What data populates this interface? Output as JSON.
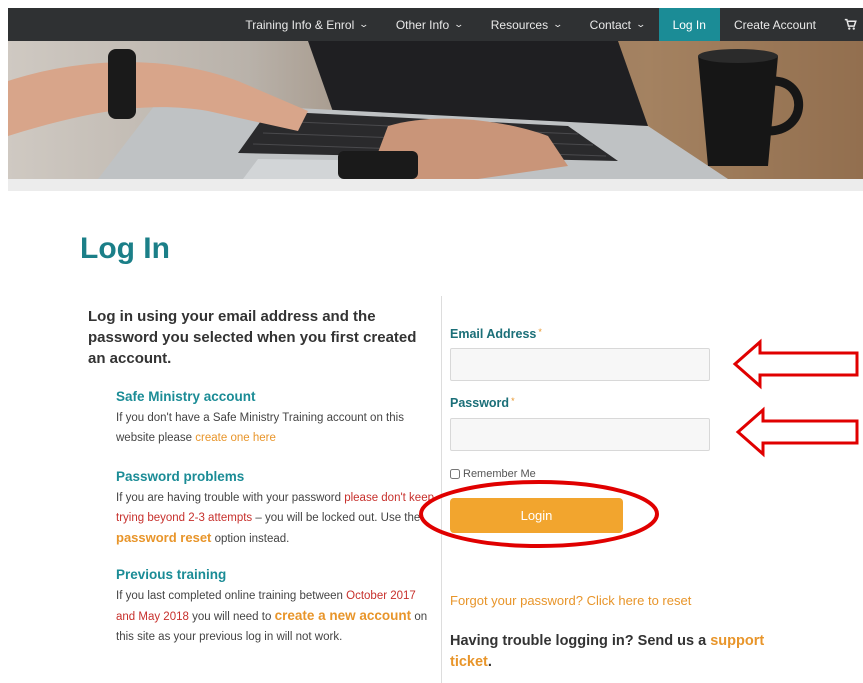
{
  "nav": {
    "items": [
      {
        "label": "Training Info & Enrol",
        "has_menu": true
      },
      {
        "label": "Other Info",
        "has_menu": true
      },
      {
        "label": "Resources",
        "has_menu": true
      },
      {
        "label": "Contact",
        "has_menu": true
      }
    ],
    "login": "Log In",
    "create_account": "Create Account",
    "cart_icon": "shopping-cart-icon",
    "chevron": "⌄",
    "cart_glyph": "🛒"
  },
  "page": {
    "title": "Log In",
    "intro": "Log in using your email address and the password you selected when you first created an account."
  },
  "info": {
    "safe_ministry": {
      "title": "Safe Ministry account",
      "text_1": "If you don't have a Safe Ministry Training account on this website please ",
      "link": "create one here"
    },
    "password_problems": {
      "title": "Password problems",
      "text_1": "If you are having trouble with your password ",
      "warning": "please don't keep trying beyond 2-3 attempts",
      "text_2": " – you will be locked out. Use the ",
      "link": "password reset",
      "text_3": " option instead."
    },
    "previous_training": {
      "title": "Previous training",
      "text_1": "If you last completed online training between ",
      "highlight": "October 2017 and May 2018",
      "text_2": " you will need to ",
      "link": "create a new account",
      "text_3": " on this site as your previous log in will not work."
    }
  },
  "form": {
    "email_label": "Email Address",
    "password_label": "Password",
    "required_mark": "*",
    "email_value": "",
    "password_value": "",
    "remember_label": "Remember Me",
    "login_button": "Login",
    "forgot_link": "Forgot your password? Click here to reset",
    "trouble_text": "Having trouble logging in? Send us a ",
    "support_link": "support ticket",
    "trouble_end": "."
  },
  "colors": {
    "brand_teal": "#1b8c96",
    "accent_orange": "#f2a52e",
    "annotation_red": "#e00000",
    "nav_bg": "#2f3133"
  }
}
